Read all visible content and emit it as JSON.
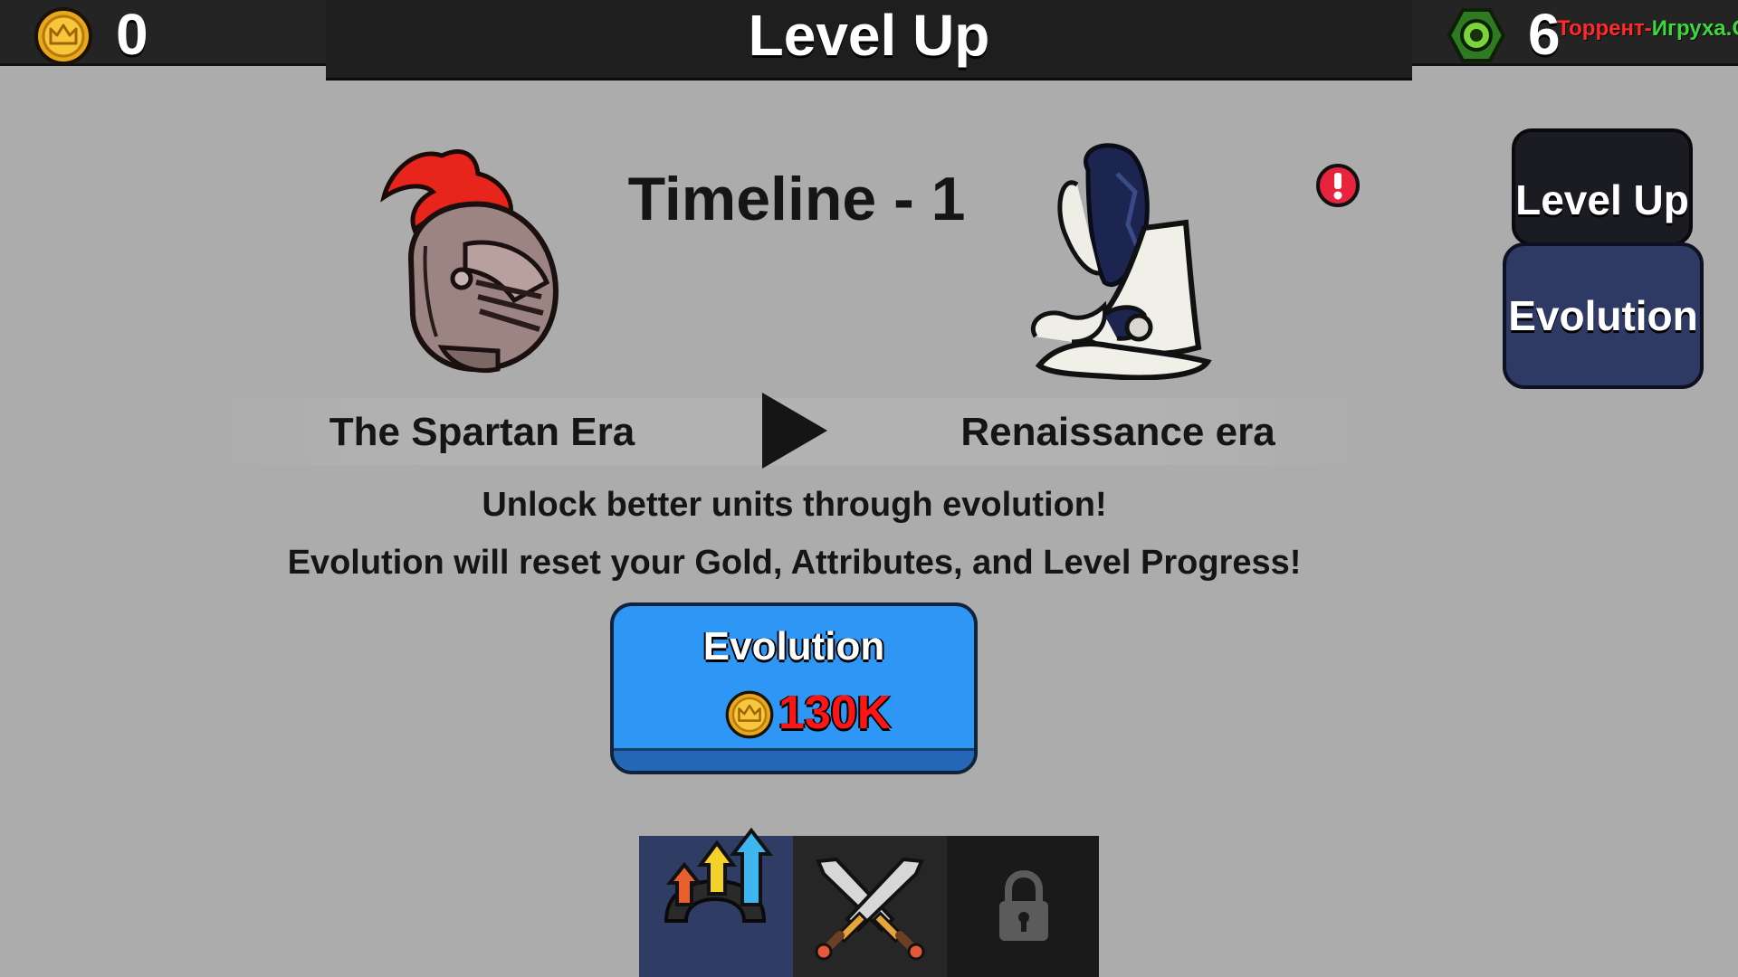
{
  "header": {
    "title": "Level Up",
    "gold_amount": "0",
    "gem_amount": "6",
    "watermark": "Торрент-Игруха.Орг"
  },
  "side_tabs": [
    {
      "label": "Level Up",
      "selected": false
    },
    {
      "label": "Evolution",
      "selected": true
    }
  ],
  "timeline": {
    "title": "Timeline - 1",
    "current_era": "The Spartan Era",
    "next_era": "Renaissance era",
    "current_era_icon": "knight-helmet-icon",
    "next_era_icon": "feathered-hat-icon"
  },
  "description": {
    "line1": "Unlock better units through evolution!",
    "line2": "Evolution will reset your Gold, Attributes, and Level Progress!"
  },
  "evolution_button": {
    "label": "Evolution",
    "price": "130K",
    "currency_icon": "gold-crown-coin-icon"
  },
  "bottom_tabs": [
    {
      "name": "upgrades",
      "icon": "upgrade-arrows-icon",
      "selected": true
    },
    {
      "name": "battle",
      "icon": "crossed-swords-icon",
      "selected": false
    },
    {
      "name": "locked",
      "icon": "padlock-icon",
      "selected": false
    }
  ],
  "colors": {
    "background": "#acacac",
    "accent_button": "#2e97f6",
    "price_text": "#ff1515",
    "selected_side_tab": "#2e3a64",
    "selected_bottom_tab": "#2f3c63"
  }
}
